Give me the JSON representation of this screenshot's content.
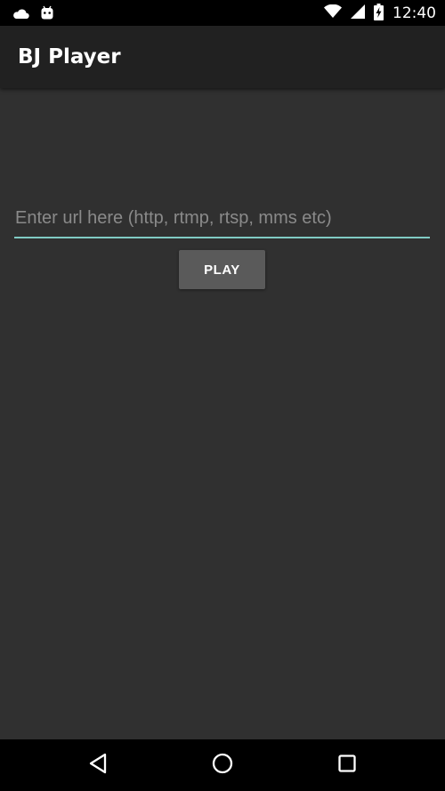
{
  "status_bar": {
    "time": "12:40",
    "icons_left": [
      "cloud-icon",
      "android-icon"
    ],
    "icons_right": [
      "wifi-icon",
      "signal-icon",
      "battery-charging-icon"
    ]
  },
  "app_bar": {
    "title": "BJ Player"
  },
  "main": {
    "url_input": {
      "placeholder": "Enter url here (http, rtmp, rtsp, mms etc)",
      "value": ""
    },
    "play_label": "PLAY"
  },
  "nav_bar": {
    "buttons": [
      "back-icon",
      "home-icon",
      "recents-icon"
    ]
  },
  "colors": {
    "background": "#303030",
    "app_bar": "#212121",
    "accent": "#80cbc4",
    "button": "#5a5a5a"
  }
}
